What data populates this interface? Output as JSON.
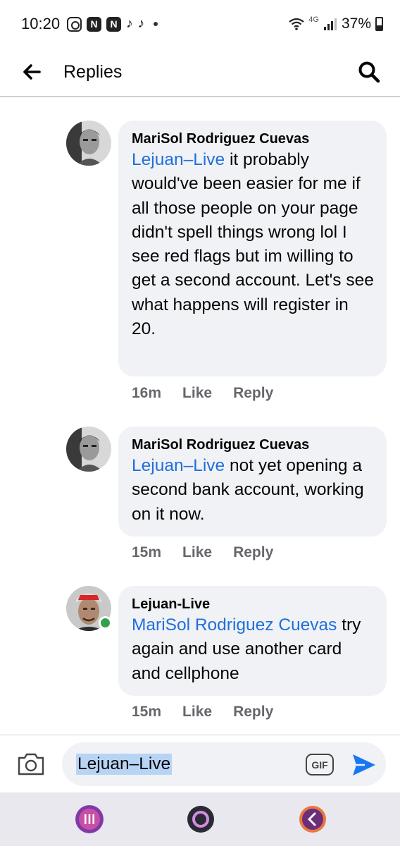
{
  "status_bar": {
    "time": "10:20",
    "network": "4G",
    "battery": "37%",
    "app_icons": [
      "instagram-icon",
      "app-n-icon",
      "app-n-icon",
      "tiktok-icon",
      "tiktok-icon",
      "dot-icon"
    ]
  },
  "header": {
    "title": "Replies"
  },
  "comments": [
    {
      "author": "MariSol Rodriguez Cuevas",
      "mention": "Lejuan–Live",
      "text": " it probably would've been easier for me if all those people on your page didn't spell things wrong lol I see red flags but im willing to get a second account.  Let's see what happens will register in 20.",
      "time": "16m",
      "like_label": "Like",
      "reply_label": "Reply"
    },
    {
      "author": "MariSol Rodriguez Cuevas",
      "mention": "Lejuan–Live",
      "text": " not yet opening a second bank account, working on it now.",
      "time": "15m",
      "like_label": "Like",
      "reply_label": "Reply"
    },
    {
      "author": "Lejuan-Live",
      "mention": "MariSol Rodriguez Cuevas",
      "text": " try again and use another card and cellphone",
      "time": "15m",
      "like_label": "Like",
      "reply_label": "Reply",
      "online": true
    }
  ],
  "composer": {
    "input_value": "Lejuan–Live",
    "gif_label": "GIF"
  },
  "colors": {
    "link": "#216fdb",
    "bubble": "#f0f2f5",
    "meta_text": "#65676b",
    "send": "#1877f2",
    "online": "#31a24c"
  }
}
